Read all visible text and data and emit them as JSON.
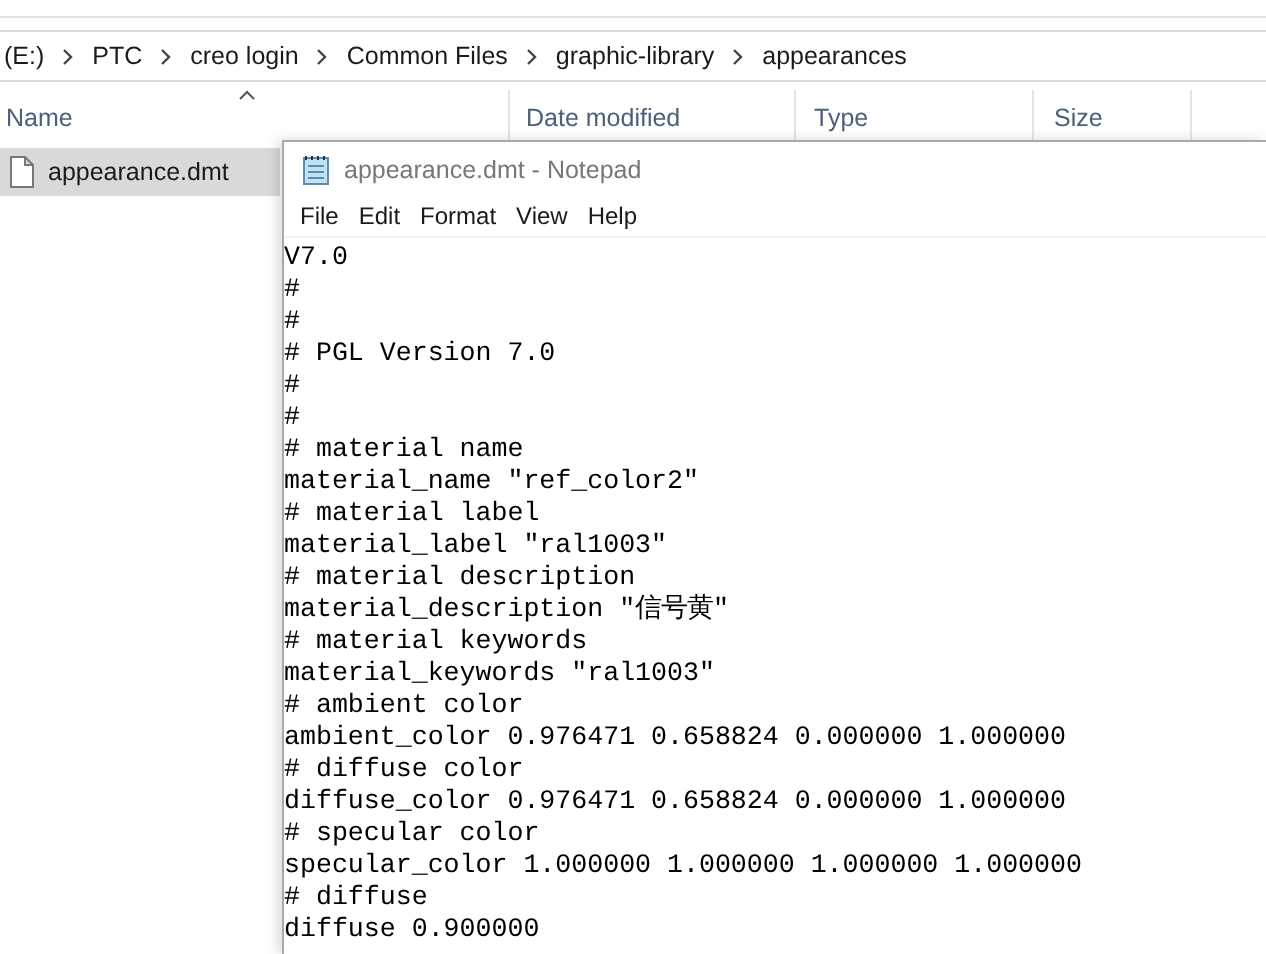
{
  "breadcrumb": [
    "(E:)",
    "PTC",
    "creo login",
    "Common Files",
    "graphic-library",
    "appearances"
  ],
  "columns": [
    {
      "label": "Name",
      "sorted": true
    },
    {
      "label": "Date modified",
      "sorted": false
    },
    {
      "label": "Type",
      "sorted": false
    },
    {
      "label": "Size",
      "sorted": false
    }
  ],
  "files": [
    {
      "name": "appearance.dmt",
      "selected": true
    }
  ],
  "notepad": {
    "title": "appearance.dmt - Notepad",
    "menu": [
      "File",
      "Edit",
      "Format",
      "View",
      "Help"
    ],
    "lines": [
      "V7.0",
      "#",
      "#",
      "# PGL Version 7.0",
      "#",
      "#",
      "# material name",
      "material_name ″ref_color2″",
      "# material label",
      "material_label ″ral1003″",
      "# material description",
      "material_description ″信号黄″",
      "# material keywords",
      "material_keywords ″ral1003″",
      "# ambient color",
      "ambient_color 0.976471 0.658824 0.000000 1.000000",
      "# diffuse color",
      "diffuse_color 0.976471 0.658824 0.000000 1.000000",
      "# specular color",
      "specular_color 1.000000 1.000000 1.000000 1.000000",
      "# diffuse",
      "diffuse 0.900000"
    ]
  }
}
